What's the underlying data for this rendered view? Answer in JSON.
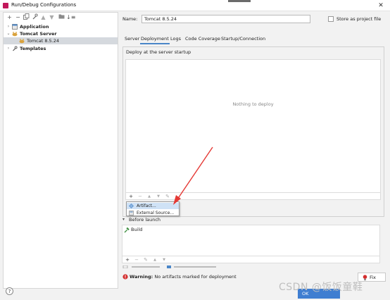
{
  "window": {
    "title": "Run/Debug Configurations",
    "close_glyph": "✕"
  },
  "left_toolbar": {
    "icons": [
      "add-icon",
      "remove-icon",
      "copy-icon",
      "wrench-icon",
      "move-up-icon",
      "move-down-icon",
      "folder-icon",
      "sort-icon"
    ]
  },
  "tree": {
    "application": "Application",
    "tomcat_server": "Tomcat Server",
    "tomcat_item": "Tomcat 8.5.24",
    "templates": "Templates"
  },
  "form": {
    "name_label": "Name:",
    "name_value": "Tomcat 8.5.24",
    "store_label": "Store as project file"
  },
  "tabs": [
    "Server",
    "Deployment",
    "Logs",
    "Code Coverage",
    "Startup/Connection"
  ],
  "active_tab": "Deployment",
  "deployment": {
    "header": "Deploy at the server startup",
    "empty_text": "Nothing to deploy",
    "menu": [
      "Artifact...",
      "External Source..."
    ]
  },
  "before_launch": {
    "header": "Before launch",
    "items": [
      "Build"
    ]
  },
  "warning": {
    "label": "Warning:",
    "text": " No artifacts marked for deployment",
    "fix": "Fix"
  },
  "buttons": {
    "ok": "OK",
    "help": "?"
  },
  "watermark": "CSDN @饭饭童鞋",
  "colors": {
    "accent": "#4a86c8",
    "arrow": "#e53935",
    "selected_row": "#d5d9de",
    "warning": "#d32f2f"
  }
}
